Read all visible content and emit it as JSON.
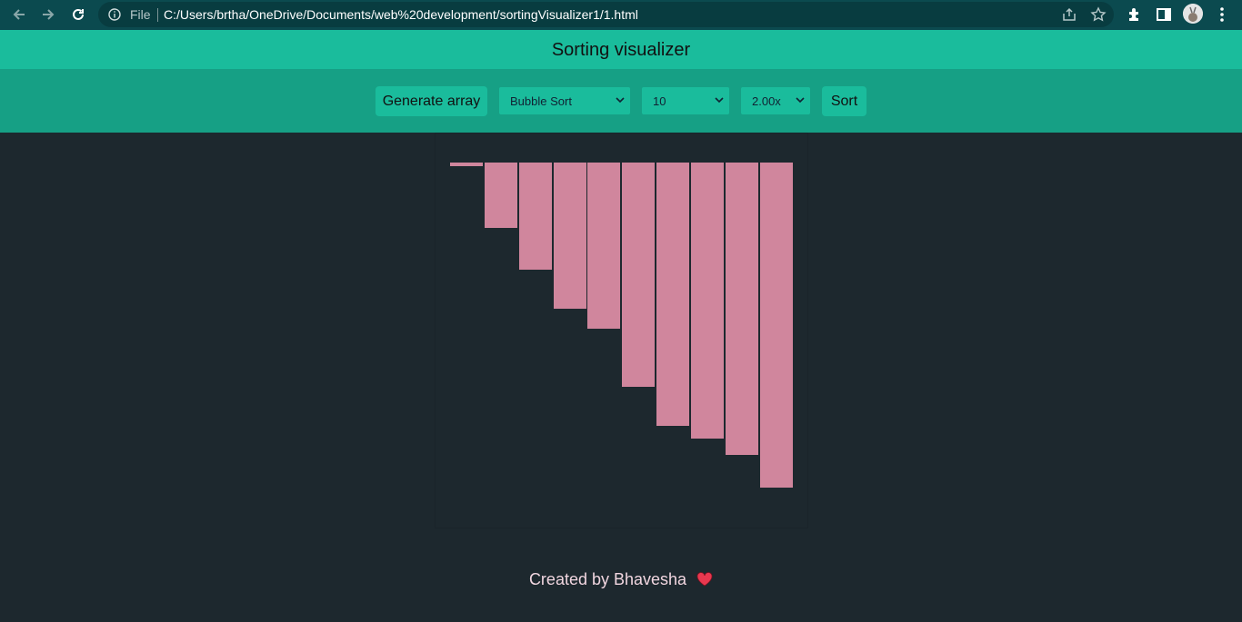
{
  "browser": {
    "file_label": "File",
    "url": "C:/Users/brtha/OneDrive/Documents/web%20development/sortingVisualizer1/1.html"
  },
  "app": {
    "title": "Sorting visualizer",
    "generate_label": "Generate array",
    "algorithm_selected": "Bubble Sort",
    "size_selected": "10",
    "speed_selected": "2.00x",
    "sort_label": "Sort"
  },
  "bars": {
    "color": "#d0869d",
    "values": [
      1,
      20,
      33,
      45,
      51,
      69,
      81,
      85,
      90,
      100
    ]
  },
  "footer": {
    "text": "Created by Bhavesha"
  },
  "colors": {
    "header": "#1abc9c",
    "controls": "#16a085",
    "background": "#1d282e"
  }
}
